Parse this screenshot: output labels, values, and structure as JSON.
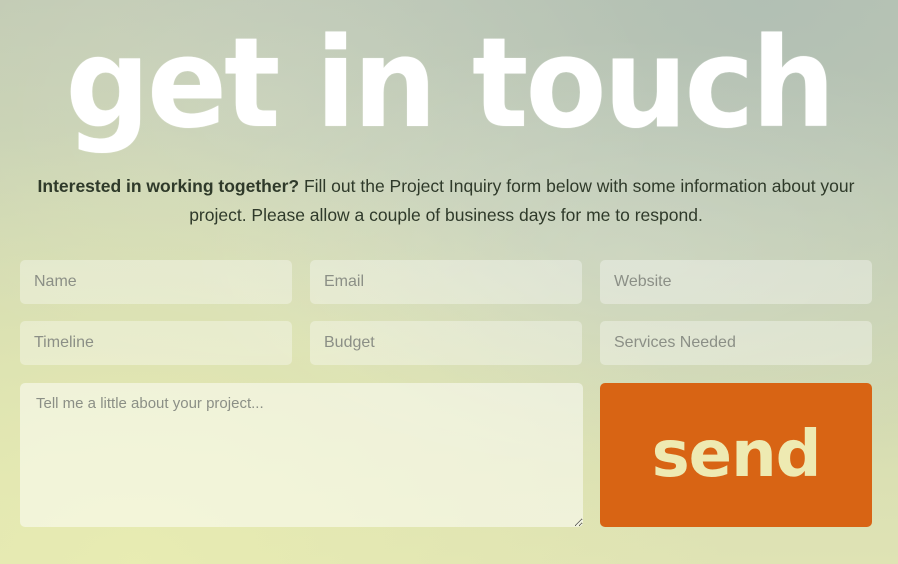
{
  "heading": "get in touch",
  "intro": {
    "bold": "Interested in working together?",
    "rest": " Fill out the Project Inquiry form below with some information about your project. Please allow a couple of business days for me to respond."
  },
  "form": {
    "name_placeholder": "Name",
    "email_placeholder": "Email",
    "website_placeholder": "Website",
    "timeline_placeholder": "Timeline",
    "budget_placeholder": "Budget",
    "services_placeholder": "Services Needed",
    "message_placeholder": "Tell me a little about your project...",
    "send_label": "send"
  },
  "colors": {
    "send_button": "#d86414",
    "send_text": "#eeeab2",
    "heading": "#ffffff"
  }
}
